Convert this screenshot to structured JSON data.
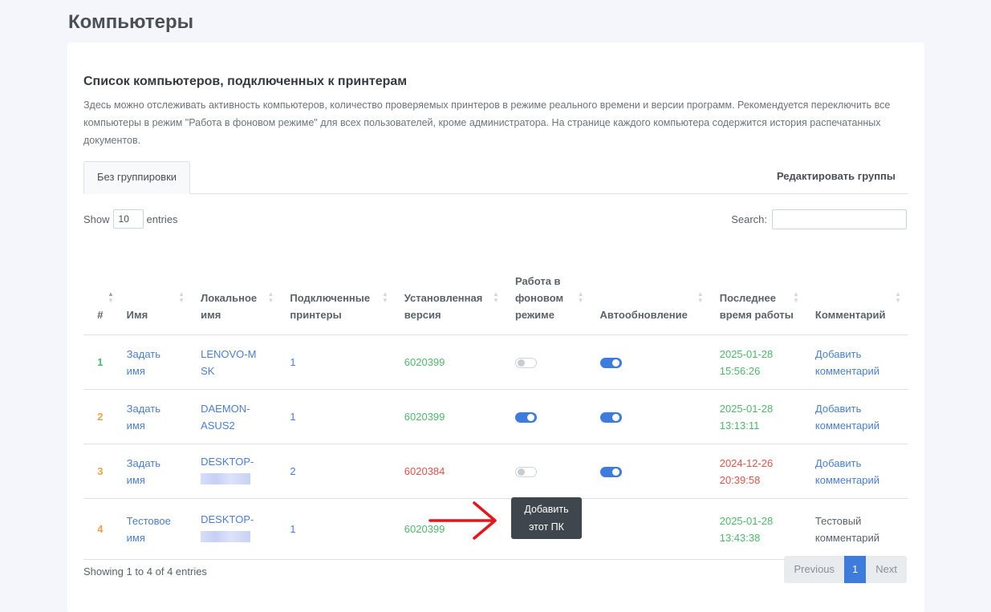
{
  "page": {
    "title": "Компьютеры"
  },
  "card": {
    "title": "Список компьютеров, подключенных к принтерам",
    "description": "Здесь можно отслеживать активность компьютеров, количество проверяемых принтеров в режиме реального времени и версии программ. Рекомендуется переключить все компьютеры в режим \"Работа в фоновом режиме\" для всех пользователей, кроме администратора. На странице каждого компьютера содержится история распечатанных документов."
  },
  "tabs": {
    "active": "Без группировки",
    "edit_groups": "Редактировать группы"
  },
  "length": {
    "show": "Show",
    "value": "10",
    "entries": "entries"
  },
  "search": {
    "label": "Search:"
  },
  "table": {
    "headers": [
      "#",
      "Имя",
      "Локальное имя",
      "Подключенные принтеры",
      "Установленная версия",
      "Работа в фоновом режиме",
      "Автообновление",
      "Последнее время работы",
      "Комментарий"
    ],
    "rows": [
      {
        "num": "1",
        "num_color": "#4fb96b",
        "name": "Задать имя",
        "local": "LENOVO-MSK",
        "printers": "1",
        "version": "6020399",
        "version_color": "#4fb96b",
        "background_mode": false,
        "auto_update": true,
        "last_time": "2025-01-28 15:56:26",
        "last_time_color": "#4fb96b",
        "comment": "Добавить комментарий",
        "comment_is_link": true
      },
      {
        "num": "2",
        "num_color": "#f0a04b",
        "name": "Задать имя",
        "local": "DAEMON-ASUS2",
        "printers": "1",
        "version": "6020399",
        "version_color": "#4fb96b",
        "background_mode": true,
        "auto_update": true,
        "last_time": "2025-01-28 13:13:11",
        "last_time_color": "#4fb96b",
        "comment": "Добавить комментарий",
        "comment_is_link": true
      },
      {
        "num": "3",
        "num_color": "#f0a04b",
        "name": "Задать имя",
        "local": "DESKTOP-",
        "printers": "2",
        "version": "6020384",
        "version_color": "#e0534a",
        "background_mode": false,
        "auto_update": true,
        "last_time": "2024-12-26 20:39:58",
        "last_time_color": "#e0534a",
        "comment": "Добавить комментарий",
        "comment_is_link": true
      },
      {
        "num": "4",
        "num_color": "#f0a04b",
        "name": "Тестовое имя",
        "local": "DESKTOP-",
        "printers": "1",
        "version": "6020399",
        "version_color": "#4fb96b",
        "background_mode": null,
        "auto_update": null,
        "last_time": "2025-01-28 13:43:38",
        "last_time_color": "#4fb96b",
        "comment": "Тестовый комментарий",
        "comment_is_link": false
      }
    ]
  },
  "tooltip": {
    "text_line1": "Добавить",
    "text_line2": "этот ПК"
  },
  "footer": {
    "info": "Showing 1 to 4 of 4 entries",
    "previous": "Previous",
    "current_page": "1",
    "next": "Next"
  },
  "colors": {
    "accent": "#3d7bdd",
    "success": "#4fb96b",
    "warning": "#f0a04b",
    "danger": "#e0534a",
    "link": "#4a7fd4",
    "annotation_arrow": "#e8131b"
  }
}
